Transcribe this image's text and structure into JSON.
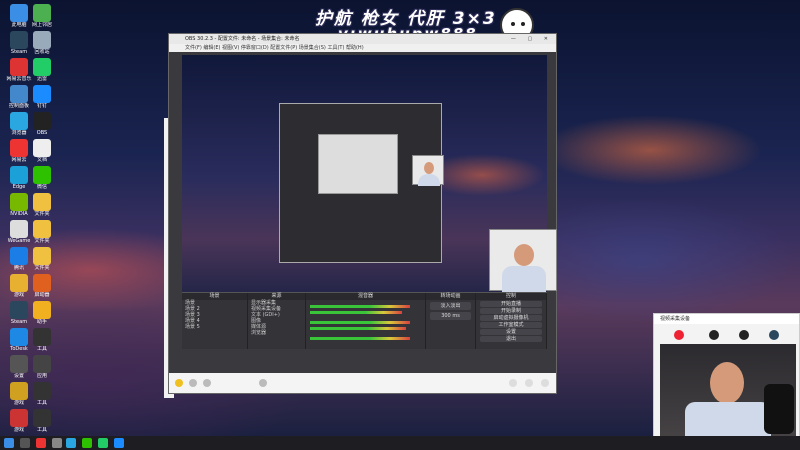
{
  "overlay": {
    "title": "护航 枪女 代肝 3×3",
    "subtitle": "v:wuhupw888"
  },
  "desktop_icons": [
    {
      "label": "此电脑",
      "icon": "computer-icon",
      "color": "#3a8ee6"
    },
    {
      "label": "网上邻居",
      "icon": "network-icon",
      "color": "#4caf50"
    },
    {
      "label": "Steam",
      "icon": "steam-icon",
      "color": "#2a475e"
    },
    {
      "label": "回收站",
      "icon": "recycle-bin-icon",
      "color": "#9ab"
    },
    {
      "label": "网易云音乐",
      "icon": "music-icon",
      "color": "#d33"
    },
    {
      "label": "迅雷",
      "icon": "download-icon",
      "color": "#2c6"
    },
    {
      "label": "控制面板",
      "icon": "control-panel-icon",
      "color": "#48c"
    },
    {
      "label": "钉钉",
      "icon": "dingtalk-icon",
      "color": "#1a8cff"
    },
    {
      "label": "浏览器",
      "icon": "browser-icon",
      "color": "#2aa6e0"
    },
    {
      "label": "OBS",
      "icon": "obs-icon",
      "color": "#222"
    },
    {
      "label": "网易云",
      "icon": "netease-icon",
      "color": "#e33"
    },
    {
      "label": "文档",
      "icon": "document-icon",
      "color": "#eee"
    },
    {
      "label": "Edge",
      "icon": "edge-icon",
      "color": "#1ba0d8"
    },
    {
      "label": "微信",
      "icon": "wechat-icon",
      "color": "#2dc100"
    },
    {
      "label": "NVIDIA",
      "icon": "nvidia-icon",
      "color": "#76b900"
    },
    {
      "label": "文件夹",
      "icon": "folder-icon",
      "color": "#f0c040"
    },
    {
      "label": "WeGame",
      "icon": "wegame-icon",
      "color": "#ddd"
    },
    {
      "label": "文件夹",
      "icon": "folder-icon",
      "color": "#f0c040"
    },
    {
      "label": "腾讯",
      "icon": "tencent-icon",
      "color": "#1a7ee6"
    },
    {
      "label": "文件夹",
      "icon": "folder-icon",
      "color": "#f0c040"
    },
    {
      "label": "游戏",
      "icon": "game-icon",
      "color": "#e8b030"
    },
    {
      "label": "启动器",
      "icon": "launcher-icon",
      "color": "#e06020"
    },
    {
      "label": "Steam",
      "icon": "steam-icon",
      "color": "#2a475e"
    },
    {
      "label": "助手",
      "icon": "assistant-icon",
      "color": "#f0b020"
    },
    {
      "label": "ToDesk",
      "icon": "todesk-icon",
      "color": "#1e88e5"
    },
    {
      "label": "工具",
      "icon": "tool-icon",
      "color": "#333"
    },
    {
      "label": "设置",
      "icon": "settings-icon",
      "color": "#555"
    },
    {
      "label": "应用",
      "icon": "app-icon",
      "color": "#444"
    },
    {
      "label": "游戏",
      "icon": "game-icon",
      "color": "#d0a020"
    },
    {
      "label": "工具",
      "icon": "tool-icon",
      "color": "#333"
    },
    {
      "label": "游戏",
      "icon": "game-icon",
      "color": "#c33"
    },
    {
      "label": "工具",
      "icon": "tool-icon",
      "color": "#333"
    }
  ],
  "obs": {
    "title": "OBS 30.2.3 - 配置文件: 未命名 - 场景集合: 未命名",
    "menu": "文件(F) 编辑(E) 视图(V) 停靠窗口(D) 配置文件(P) 场景集合(S) 工具(T) 帮助(H)",
    "docks": {
      "scenes": {
        "title": "场景",
        "items": [
          "场景",
          "场景 2",
          "场景 3",
          "场景 4",
          "场景 5"
        ]
      },
      "sources": {
        "title": "来源",
        "items": [
          "显示器采集",
          "视频采集设备",
          "文本 (GDI+)",
          "图像",
          "媒体源",
          "浏览器"
        ]
      },
      "mixer": {
        "title": "混音器"
      },
      "transitions": {
        "title": "转场动画",
        "mode": "淡入淡出",
        "duration": "300 ms"
      },
      "controls": {
        "title": "控制",
        "buttons": [
          "开始直播",
          "开始录制",
          "启动虚拟摄像机",
          "工作室模式",
          "设置",
          "退出"
        ]
      }
    }
  },
  "camera_window": {
    "title": "视频采集设备"
  }
}
